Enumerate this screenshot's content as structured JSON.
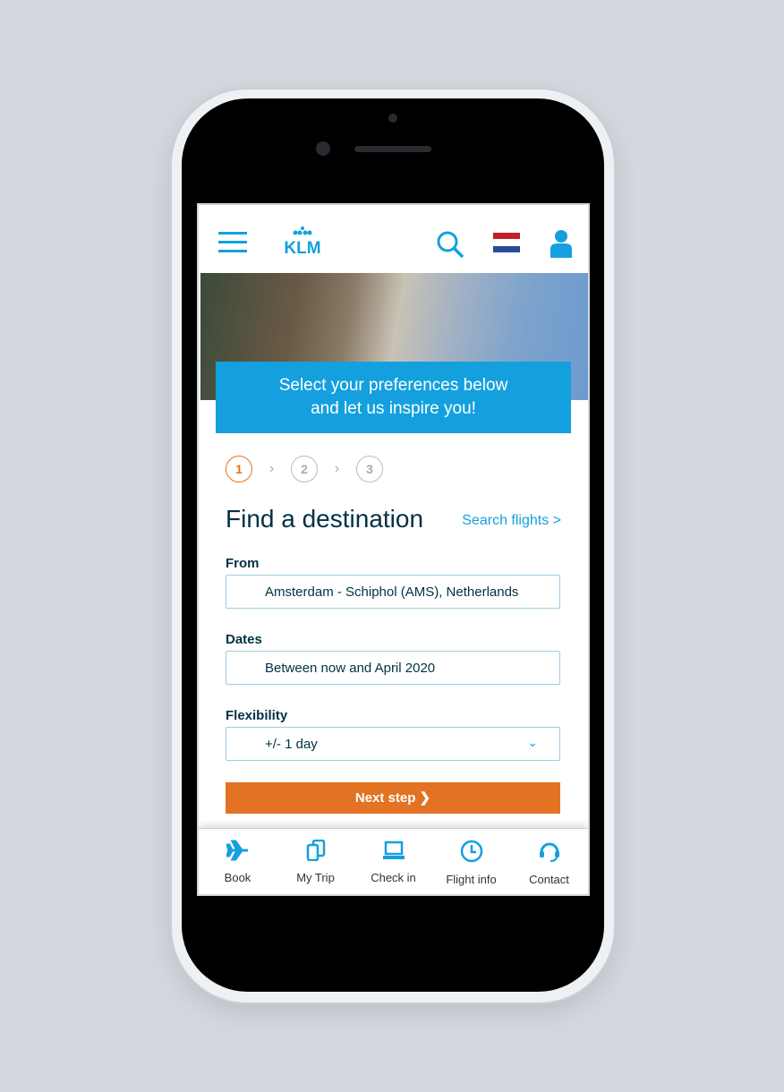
{
  "header": {
    "logo": "KLM"
  },
  "banner": {
    "line1": "Select your preferences below",
    "line2": "and let us inspire you!"
  },
  "steps": [
    "1",
    "2",
    "3"
  ],
  "form": {
    "title": "Find a destination",
    "search_flights": "Search flights >",
    "from_label": "From",
    "from_value": "Amsterdam - Schiphol (AMS), Netherlands",
    "dates_label": "Dates",
    "dates_value": "Between now and April 2020",
    "flex_label": "Flexibility",
    "flex_value": "+/- 1 day",
    "next": "Next step  ❯"
  },
  "nav": [
    {
      "label": "Book",
      "icon": "plane-icon"
    },
    {
      "label": "My Trip",
      "icon": "documents-icon"
    },
    {
      "label": "Check in",
      "icon": "laptop-icon"
    },
    {
      "label": "Flight info",
      "icon": "clock-icon"
    },
    {
      "label": "Contact",
      "icon": "headset-icon"
    }
  ],
  "colors": {
    "brand": "#14a0de",
    "accent": "#e37222"
  }
}
